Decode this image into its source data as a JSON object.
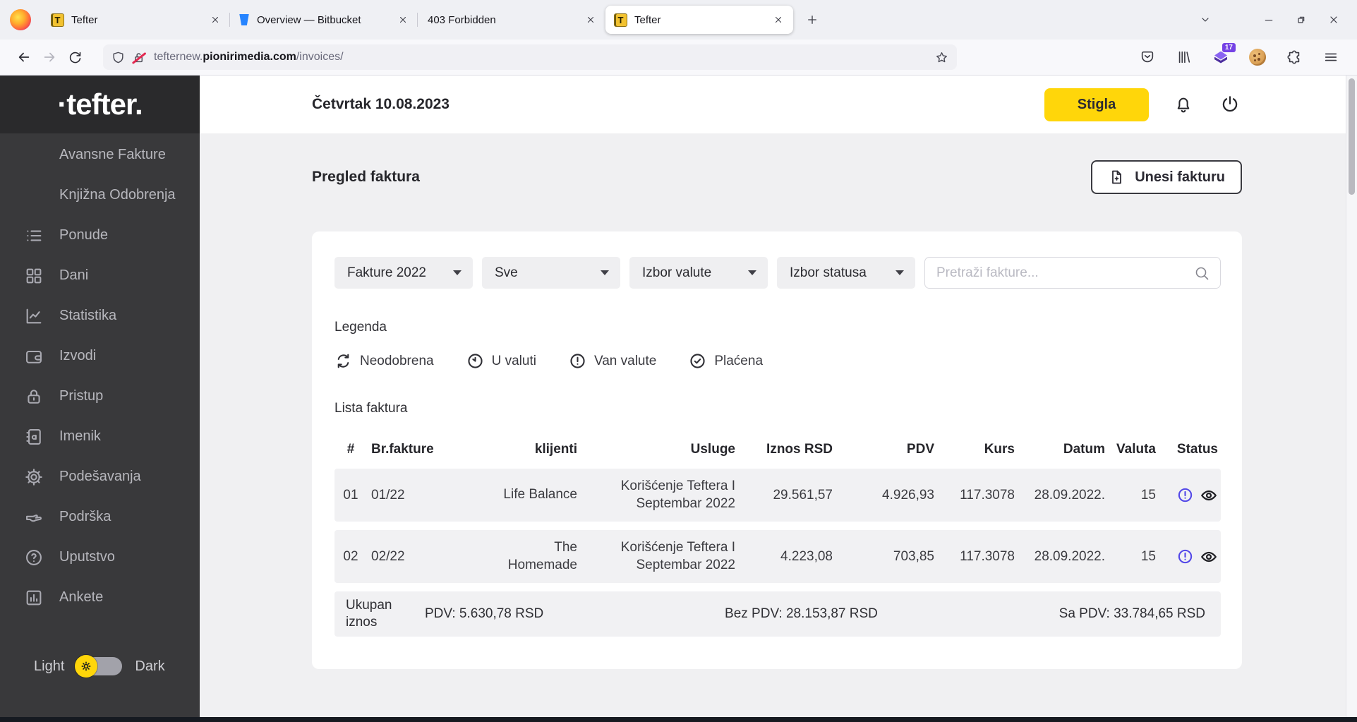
{
  "browser": {
    "tabs": [
      {
        "title": "Tefter",
        "favicon": "tefter"
      },
      {
        "title": "Overview — Bitbucket",
        "favicon": "bitbucket"
      },
      {
        "title": "403 Forbidden",
        "favicon": "none"
      },
      {
        "title": "Tefter",
        "favicon": "tefter"
      }
    ],
    "tefter_favicon_letter": "T",
    "address": {
      "prefix": "tefternew.",
      "domain": "pionirimedia.com",
      "path": "/invoices/"
    },
    "extension_badge": "17"
  },
  "sidebar": {
    "logo": "·tefter.",
    "items": [
      {
        "label": "Avansne Fakture",
        "icon": "none"
      },
      {
        "label": "Knjižna Odobrenja",
        "icon": "none"
      },
      {
        "label": "Ponude",
        "icon": "list-icon"
      },
      {
        "label": "Dani",
        "icon": "grid-icon"
      },
      {
        "label": "Statistika",
        "icon": "line-chart-icon"
      },
      {
        "label": "Izvodi",
        "icon": "wallet-icon"
      },
      {
        "label": "Pristup",
        "icon": "lock-icon"
      },
      {
        "label": "Imenik",
        "icon": "address-book-icon"
      },
      {
        "label": "Podešavanja",
        "icon": "gear-icon"
      },
      {
        "label": "Podrška",
        "icon": "support-hand-icon"
      },
      {
        "label": "Uputstvo",
        "icon": "help-circle-icon"
      },
      {
        "label": "Ankete",
        "icon": "bar-chart-icon"
      }
    ],
    "theme": {
      "light": "Light",
      "dark": "Dark"
    }
  },
  "header": {
    "date": "Četvrtak 10.08.2023",
    "inbox_button": "Stigla"
  },
  "page": {
    "title": "Pregled faktura",
    "add_invoice_button": "Unesi fakturu",
    "filters": {
      "year": "Fakture 2022",
      "type": "Sve",
      "currency": "Izbor valute",
      "status": "Izbor statusa",
      "search_placeholder": "Pretraži fakture..."
    },
    "legend": {
      "title": "Legenda",
      "items": [
        {
          "label": "Neodobrena",
          "icon": "refresh-icon"
        },
        {
          "label": "U valuti",
          "icon": "clock-icon"
        },
        {
          "label": "Van valute",
          "icon": "exclamation-circle-icon"
        },
        {
          "label": "Plaćena",
          "icon": "check-circle-icon"
        }
      ]
    },
    "table": {
      "title": "Lista faktura",
      "columns": [
        "#",
        "Br.fakture",
        "klijenti",
        "Usluge",
        "Iznos RSD",
        "PDV",
        "Kurs",
        "Datum",
        "Valuta",
        "Status"
      ],
      "rows": [
        {
          "num": "01",
          "invoice_no": "01/22",
          "client": "Life Balance",
          "service": "Korišćenje Teftera I\nSeptembar 2022",
          "amount_rsd": "29.561,57",
          "pdv": "4.926,93",
          "kurs": "117.3078",
          "date": "28.09.2022.",
          "valuta": "15",
          "status_icon": "exclamation-circle-icon",
          "action_icon": "eye-icon"
        },
        {
          "num": "02",
          "invoice_no": "02/22",
          "client": "The\nHomemade",
          "service": "Korišćenje Teftera I\nSeptembar 2022",
          "amount_rsd": "4.223,08",
          "pdv": "703,85",
          "kurs": "117.3078",
          "date": "28.09.2022.",
          "valuta": "15",
          "status_icon": "exclamation-circle-icon",
          "action_icon": "eye-icon"
        }
      ],
      "totals": {
        "label": "Ukupan iznos",
        "pdv": "PDV: 5.630,78 RSD",
        "without_pdv": "Bez PDV: 28.153,87 RSD",
        "with_pdv": "Sa PDV: 33.784,65 RSD"
      }
    }
  },
  "colors": {
    "accent_yellow": "#ffd60a",
    "sidebar_bg": "#39393b",
    "status_purple": "#5348e8"
  }
}
